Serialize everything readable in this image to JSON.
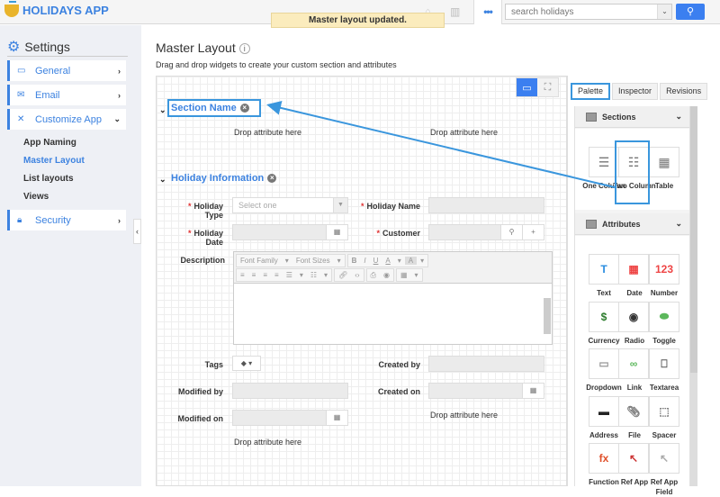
{
  "app": {
    "title": "HOLIDAYS APP"
  },
  "toast": "Master layout updated.",
  "topbar": {
    "more_label": "•••",
    "search": {
      "placeholder": "search holidays"
    }
  },
  "sidebar": {
    "heading": "Settings",
    "items": [
      {
        "label": "General",
        "icon": "monitor-icon"
      },
      {
        "label": "Email",
        "icon": "envelope-icon"
      },
      {
        "label": "Customize App",
        "icon": "tools-icon"
      },
      {
        "label": "Security",
        "icon": "lock-icon"
      }
    ],
    "subitems": [
      {
        "label": "App Naming",
        "active": false
      },
      {
        "label": "Master Layout",
        "active": true
      },
      {
        "label": "List layouts",
        "active": false
      },
      {
        "label": "Views",
        "active": false
      }
    ]
  },
  "main": {
    "title": "Master Layout",
    "subtitle": "Drag and drop widgets to create your custom section and attributes",
    "sections": [
      {
        "name": "Section Name",
        "drops": [
          "Drop attribute here",
          "Drop attribute here"
        ]
      },
      {
        "name": "Holiday Information"
      }
    ],
    "fields": {
      "holiday_type": {
        "label": "Holiday Type",
        "placeholder": "Select one",
        "required": true
      },
      "holiday_name": {
        "label": "Holiday Name",
        "required": true
      },
      "holiday_date": {
        "label": "Holiday Date",
        "required": true
      },
      "customer": {
        "label": "Customer",
        "required": true
      },
      "description": {
        "label": "Description"
      },
      "tags": {
        "label": "Tags"
      },
      "created_by": {
        "label": "Created by"
      },
      "modified_by": {
        "label": "Modified by"
      },
      "created_on": {
        "label": "Created on"
      },
      "modified_on": {
        "label": "Modified on"
      }
    },
    "editor": {
      "font_family": "Font Family",
      "font_sizes": "Font Sizes",
      "bold": "B",
      "italic": "I",
      "underline": "U",
      "font_color": "A",
      "bg_color": "A"
    },
    "drop_left": "Drop attribute here",
    "drop_right": "Drop attribute here"
  },
  "panel": {
    "tabs": [
      {
        "label": "Palette",
        "active": true
      },
      {
        "label": "Inspector",
        "active": false
      },
      {
        "label": "Revisions",
        "active": false
      }
    ],
    "sections_header": "Sections",
    "section_widgets": [
      "One Column",
      "Two Column",
      "Table"
    ],
    "attributes_header": "Attributes",
    "attribute_widgets": [
      "Text",
      "Date",
      "Number",
      "Currency",
      "Radio",
      "Toggle",
      "Dropdown",
      "Link",
      "Textarea",
      "Address",
      "File",
      "Spacer",
      "Function",
      "Ref App",
      "Ref App Field"
    ]
  },
  "colors": {
    "accent": "#3c82e0",
    "highlight": "#3a96dd",
    "toast_bg": "#fbecbd"
  }
}
